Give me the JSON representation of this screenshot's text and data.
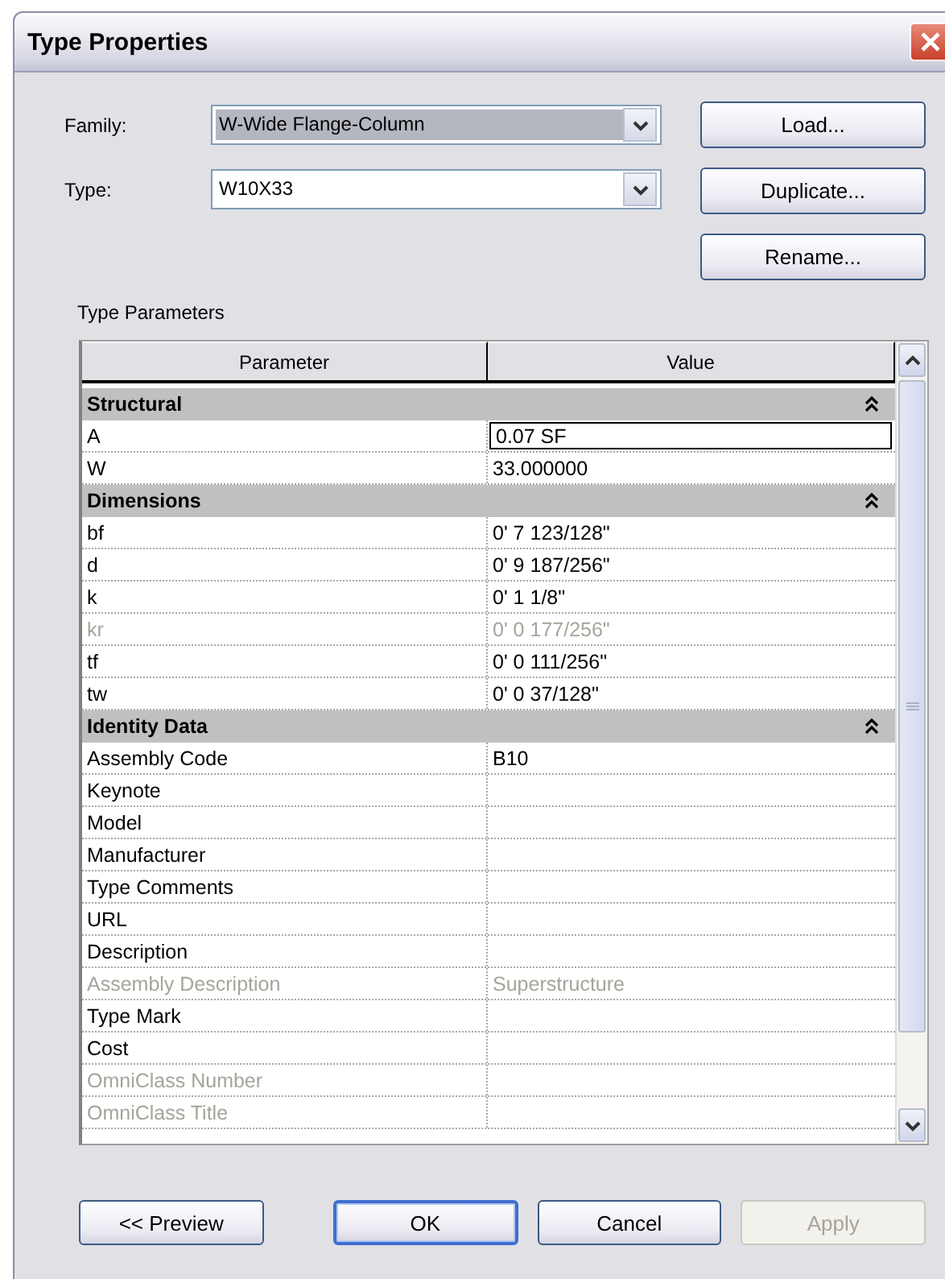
{
  "window": {
    "title": "Type Properties"
  },
  "family": {
    "label": "Family:",
    "value": "W-Wide Flange-Column",
    "focused": true
  },
  "type": {
    "label": "Type:",
    "value": "W10X33",
    "focused": false
  },
  "side_buttons": [
    {
      "label": "Load..."
    },
    {
      "label": "Duplicate..."
    },
    {
      "label": "Rename..."
    }
  ],
  "section_label": "Type Parameters",
  "table": {
    "columns": [
      "Parameter",
      "Value"
    ],
    "rows": [
      {
        "kind": "group",
        "label": "Structural",
        "expanded": true
      },
      {
        "kind": "param",
        "name": "A",
        "value": "0.07 SF",
        "disabled": false,
        "editing": true
      },
      {
        "kind": "param",
        "name": "W",
        "value": "33.000000",
        "disabled": false,
        "editing": false
      },
      {
        "kind": "group",
        "label": "Dimensions",
        "expanded": true
      },
      {
        "kind": "param",
        "name": "bf",
        "value": "0'  7 123/128\"",
        "disabled": false,
        "editing": false
      },
      {
        "kind": "param",
        "name": "d",
        "value": "0'  9 187/256\"",
        "disabled": false,
        "editing": false
      },
      {
        "kind": "param",
        "name": "k",
        "value": "0'  1 1/8\"",
        "disabled": false,
        "editing": false
      },
      {
        "kind": "param",
        "name": "kr",
        "value": "0'  0 177/256\"",
        "disabled": true,
        "editing": false
      },
      {
        "kind": "param",
        "name": "tf",
        "value": "0'  0 111/256\"",
        "disabled": false,
        "editing": false
      },
      {
        "kind": "param",
        "name": "tw",
        "value": "0'  0 37/128\"",
        "disabled": false,
        "editing": false
      },
      {
        "kind": "group",
        "label": "Identity Data",
        "expanded": true
      },
      {
        "kind": "param",
        "name": "Assembly Code",
        "value": "B10",
        "disabled": false,
        "editing": false
      },
      {
        "kind": "param",
        "name": "Keynote",
        "disabled": false,
        "editing": false
      },
      {
        "kind": "param",
        "name": "Model",
        "disabled": false,
        "editing": false
      },
      {
        "kind": "param",
        "name": "Manufacturer",
        "disabled": false,
        "editing": false
      },
      {
        "kind": "param",
        "name": "Type Comments",
        "disabled": false,
        "editing": false
      },
      {
        "kind": "param",
        "name": "URL",
        "disabled": false,
        "editing": false
      },
      {
        "kind": "param",
        "name": "Description",
        "disabled": false,
        "editing": false
      },
      {
        "kind": "param",
        "name": "Assembly Description",
        "value": "Superstructure",
        "disabled": true,
        "editing": false
      },
      {
        "kind": "param",
        "name": "Type Mark",
        "disabled": false,
        "editing": false
      },
      {
        "kind": "param",
        "name": "Cost",
        "disabled": false,
        "editing": false
      },
      {
        "kind": "param",
        "name": "OmniClass Number",
        "disabled": true,
        "editing": false
      },
      {
        "kind": "param",
        "name": "OmniClass Title",
        "disabled": true,
        "editing": false
      }
    ]
  },
  "footer_buttons": [
    {
      "label": "<< Preview",
      "disabled": false,
      "default": false
    },
    {
      "label": "OK",
      "disabled": false,
      "default": true
    },
    {
      "label": "Cancel",
      "disabled": false,
      "default": false
    },
    {
      "label": "Apply",
      "disabled": true,
      "default": false
    }
  ]
}
